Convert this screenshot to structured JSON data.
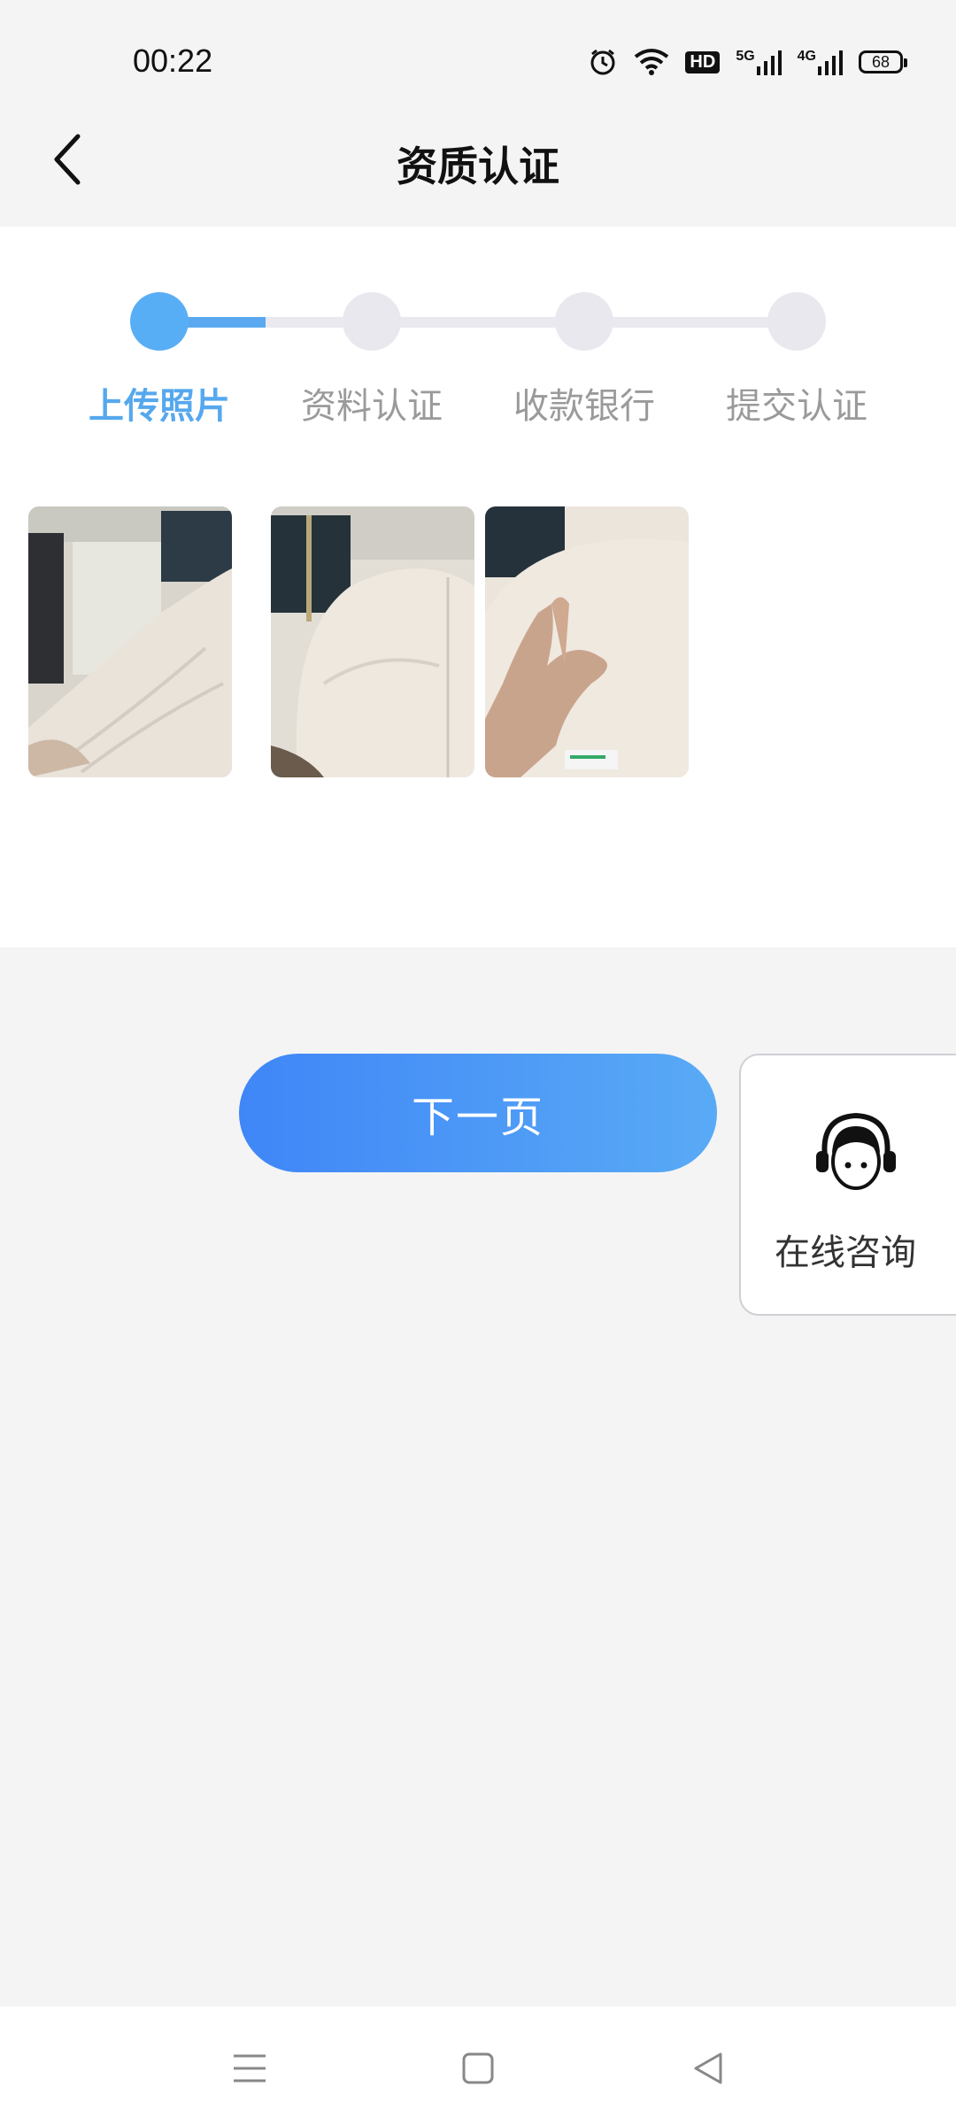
{
  "status_bar": {
    "time": "00:22",
    "hd_label": "HD",
    "net1": "5G",
    "net2": "4G",
    "battery": "68",
    "icons": [
      "alarm-icon",
      "wifi-icon",
      "hd-icon",
      "signal-5g-icon",
      "signal-4g-icon",
      "battery-icon"
    ]
  },
  "header": {
    "title": "资质认证",
    "back_icon": "chevron-left-icon"
  },
  "steps": {
    "current_step": 1,
    "progress_fraction": 0.5,
    "items": [
      {
        "label": "上传照片"
      },
      {
        "label": "资料认证"
      },
      {
        "label": "收款银行"
      },
      {
        "label": "提交认证"
      }
    ]
  },
  "photos": {
    "count": 3,
    "items": [
      "photo-1",
      "photo-2",
      "photo-3"
    ]
  },
  "next_button": {
    "label": "下一页"
  },
  "consult": {
    "label": "在线咨询",
    "icon": "headset-agent-icon"
  },
  "nav": {
    "icons": [
      "menu-icon",
      "home-icon",
      "back-triangle-icon"
    ]
  },
  "colors": {
    "accent": "#58aef5",
    "button_start": "#3f86f7",
    "button_end": "#59aaf6",
    "inactive": "#9a9a9a"
  }
}
